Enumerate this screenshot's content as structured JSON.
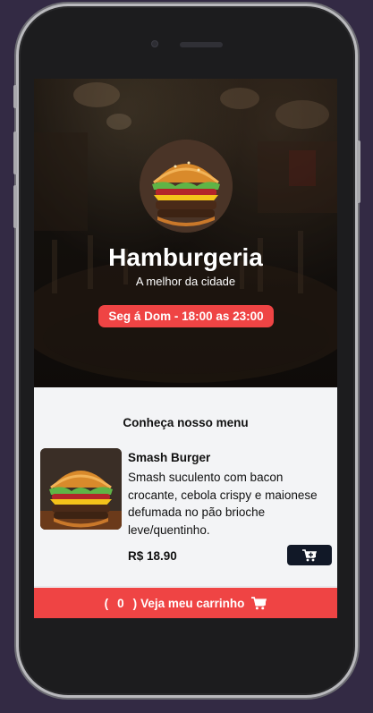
{
  "restaurant": {
    "name": "Hamburgeria",
    "tagline": "A melhor da cidade",
    "hours": "Seg á Dom - 18:00 as 23:00"
  },
  "menu": {
    "heading": "Conheça nosso menu",
    "items": [
      {
        "name": "Smash Burger",
        "description": "Smash suculento com bacon crocante, cebola crispy e maionese defumada no pão brioche leve/quentinho.",
        "price": "R$ 18.90",
        "add_icon": "add-to-cart-icon"
      }
    ]
  },
  "cart": {
    "open_paren": "(",
    "count": "0",
    "close_paren": ")",
    "label": "Veja meu carrinho",
    "icon": "cart-icon"
  },
  "colors": {
    "accent": "#ef4444",
    "button_dark": "#111827",
    "page_bg": "#f3f4f6",
    "frame_bg": "#332a44"
  }
}
